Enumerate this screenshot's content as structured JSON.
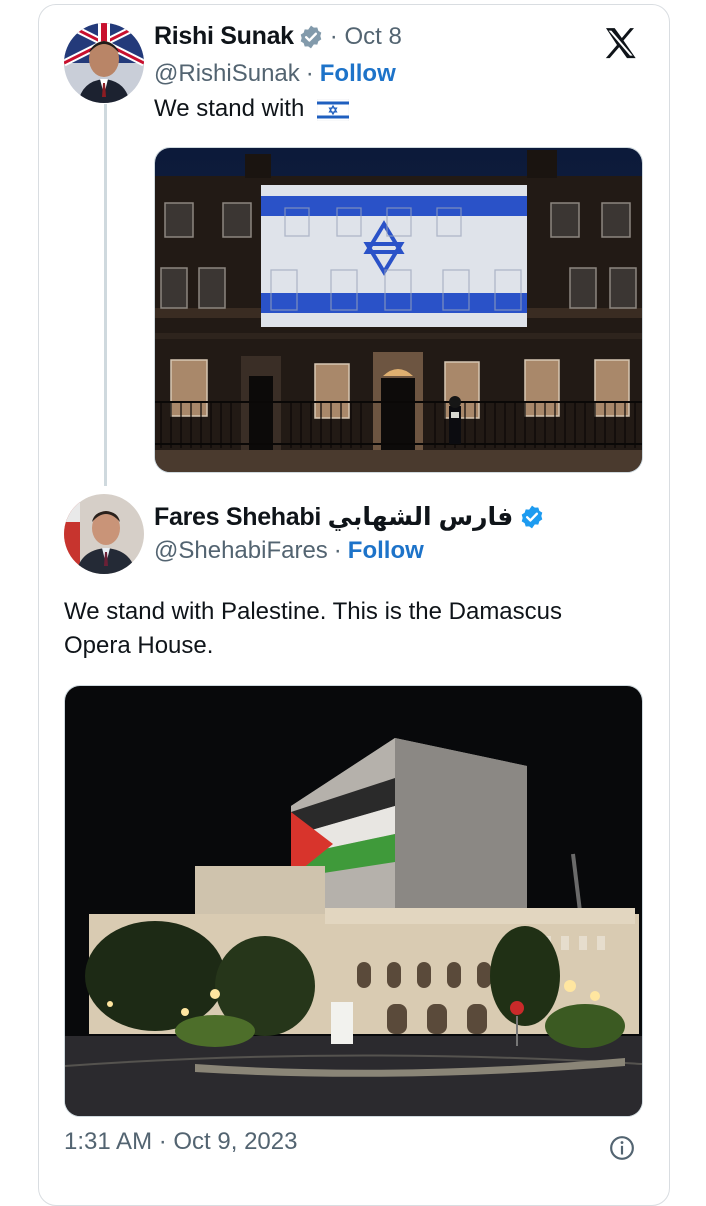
{
  "tweet1": {
    "name": "Rishi Sunak",
    "date": "· Oct 8",
    "handle": "@RishiSunak",
    "dot": "·",
    "follow": "Follow",
    "text": "We stand with",
    "emoji": "israel-flag-emoji",
    "image_description": "10 Downing Street with Israeli flag projection"
  },
  "tweet2": {
    "name": "Fares Shehabi فارس الشهابي",
    "handle": "@ShehabiFares",
    "dot": "·",
    "follow": "Follow",
    "text_line1": "We stand with Palestine. This is the Damascus",
    "text_line2": "Opera House."
  },
  "footer": {
    "timestamp": "1:31 AM · Oct 9, 2023"
  },
  "icons": {
    "logo": "x-logo-icon",
    "verified": "verified-badge-icon",
    "info": "info-icon"
  },
  "colors": {
    "follow": "#1d73c9",
    "verified": "#1d9bf0",
    "secondary_text": "#536471"
  }
}
